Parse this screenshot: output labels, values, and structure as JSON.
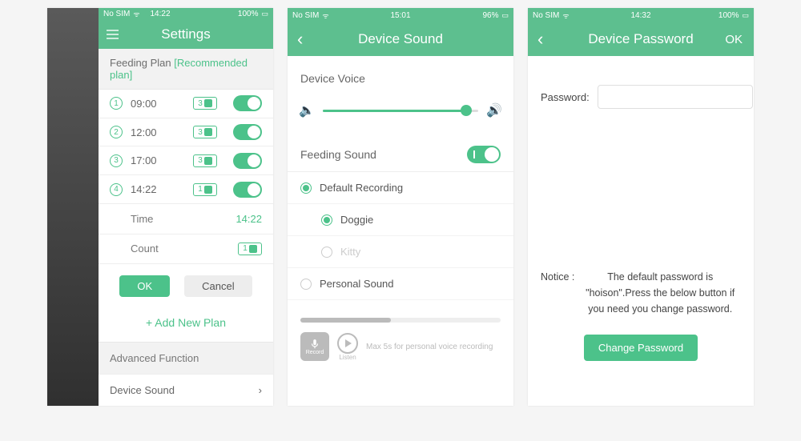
{
  "screen1": {
    "status": {
      "carrier": "No SIM",
      "time": "14:22",
      "battery": "100%"
    },
    "title": "Settings",
    "feeding_plan_label": "Feeding Plan",
    "recommended_label": "[Recommended plan]",
    "plans": [
      {
        "idx": "1",
        "time": "09:00",
        "portion": "3"
      },
      {
        "idx": "2",
        "time": "12:00",
        "portion": "3"
      },
      {
        "idx": "3",
        "time": "17:00",
        "portion": "3"
      },
      {
        "idx": "4",
        "time": "14:22",
        "portion": "1"
      }
    ],
    "time_label": "Time",
    "time_value": "14:22",
    "count_label": "Count",
    "count_value": "1",
    "ok_label": "OK",
    "cancel_label": "Cancel",
    "add_plan_label": "+ Add New Plan",
    "advanced_label": "Advanced Function",
    "device_sound_label": "Device Sound"
  },
  "screen2": {
    "status": {
      "carrier": "No SIM",
      "time": "15:01",
      "battery": "96%"
    },
    "title": "Device Sound",
    "device_voice_label": "Device Voice",
    "feeding_sound_label": "Feeding Sound",
    "default_recording_label": "Default Recording",
    "doggie_label": "Doggie",
    "kitty_label": "Kitty",
    "personal_sound_label": "Personal Sound",
    "record_label": "Record",
    "listen_label": "Listen",
    "recording_note": "Max 5s for personal voice recording"
  },
  "screen3": {
    "status": {
      "carrier": "No SIM",
      "time": "14:32",
      "battery": "100%"
    },
    "title": "Device Password",
    "ok_label": "OK",
    "password_label": "Password:",
    "notice_label": "Notice :",
    "notice_text": "The default password is \"hoison\".Press the below button if you need you change password.",
    "change_label": "Change Password"
  }
}
